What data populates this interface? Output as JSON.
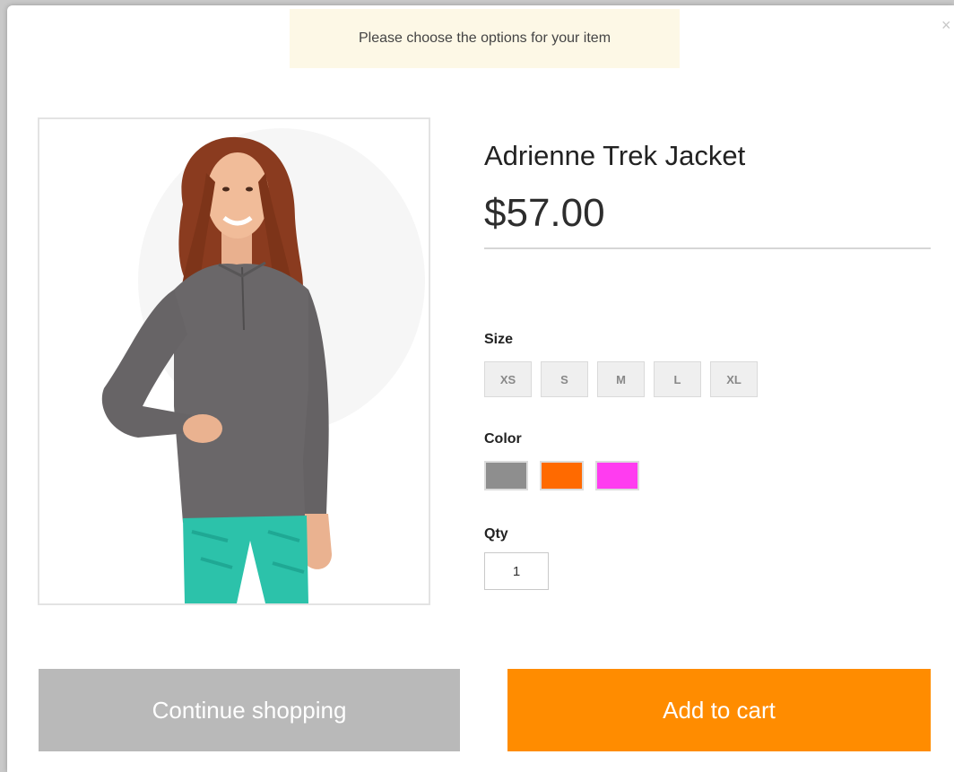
{
  "modal": {
    "close_glyph": "×",
    "notice": "Please choose the options for your item"
  },
  "product": {
    "name": "Adrienne Trek Jacket",
    "price": "$57.00",
    "image_icon": "product-photo"
  },
  "options": {
    "size_label": "Size",
    "sizes": [
      "XS",
      "S",
      "M",
      "L",
      "XL"
    ],
    "color_label": "Color",
    "colors": [
      "#8e8e8e",
      "#ff6a00",
      "#ff3cf0"
    ],
    "qty_label": "Qty",
    "qty_value": "1"
  },
  "actions": {
    "continue_label": "Continue shopping",
    "add_to_cart_label": "Add to cart"
  },
  "colors": {
    "notice_bg": "#fdf8e6",
    "continue_bg": "#b9b9b9",
    "cart_bg": "#ff8c00"
  }
}
